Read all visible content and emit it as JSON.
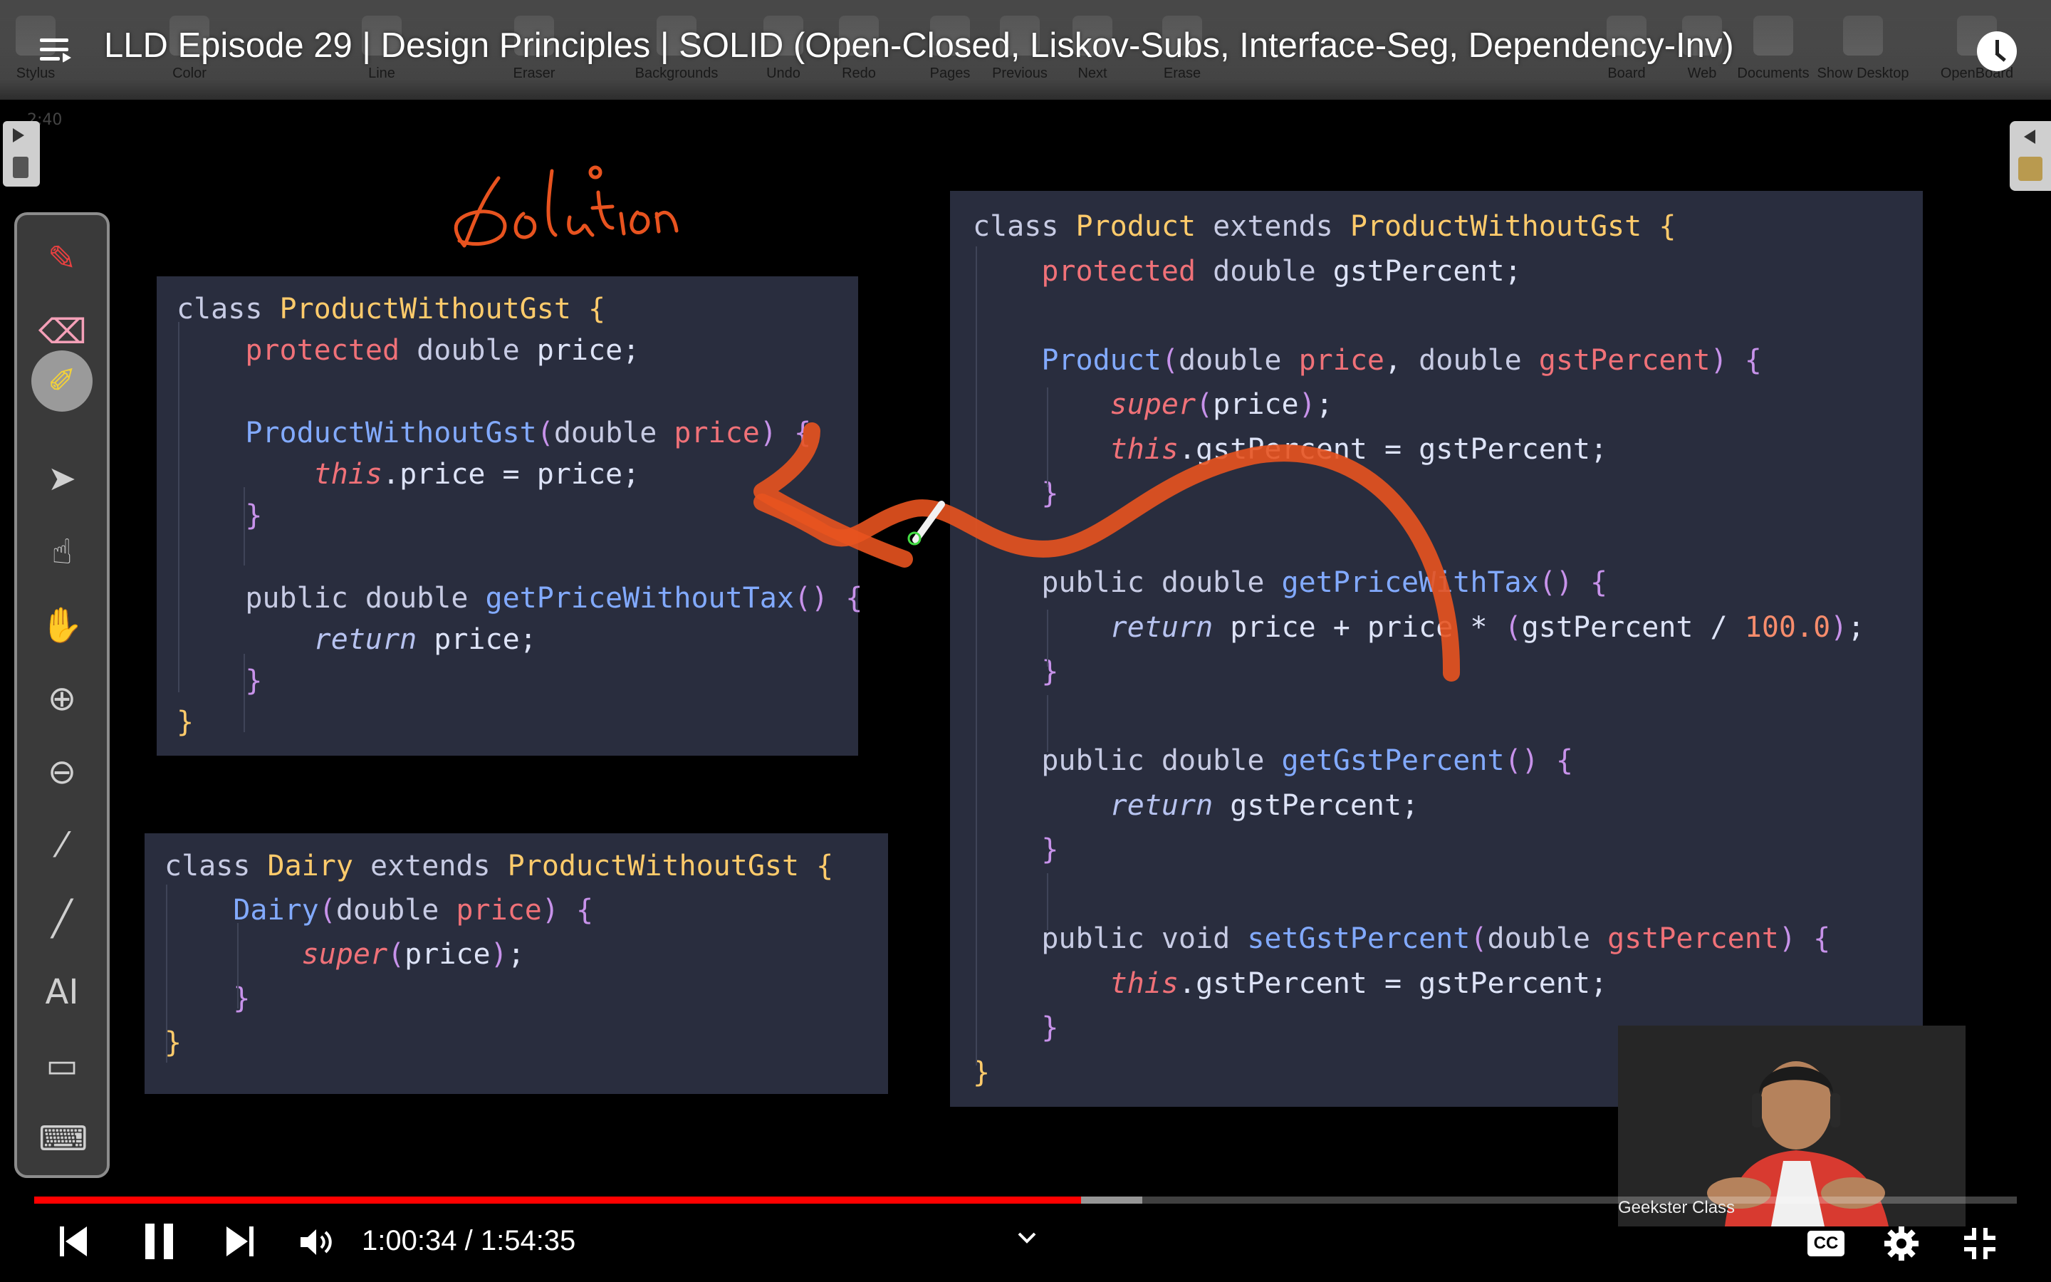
{
  "video": {
    "title": "LLD Episode 29 | Design Principles | SOLID (Open-Closed, Liskov-Subs, Interface-Seg, Dependency-Inv)",
    "current_time": "1:00:34",
    "separator": "/",
    "duration": "1:54:35",
    "progress_fraction": 0.528,
    "buffered_fraction": 0.559,
    "progress_color": "#ff0000"
  },
  "board_toolbar": {
    "items": [
      {
        "label": "Stylus",
        "icon": "stylus-icon"
      },
      {
        "label": "Color",
        "icon": "color-icon"
      },
      {
        "label": "Line",
        "icon": "line-icon"
      },
      {
        "label": "Eraser",
        "icon": "eraser-icon"
      },
      {
        "label": "Backgrounds",
        "icon": "background-icon"
      },
      {
        "label": "Undo",
        "icon": "undo-icon"
      },
      {
        "label": "Redo",
        "icon": "redo-icon"
      },
      {
        "label": "Pages",
        "icon": "pages-icon"
      },
      {
        "label": "Previous",
        "icon": "previous-icon"
      },
      {
        "label": "Next",
        "icon": "next-icon"
      },
      {
        "label": "Erase",
        "icon": "erase-icon"
      },
      {
        "label": "Board",
        "icon": "board-icon"
      },
      {
        "label": "Web",
        "icon": "web-icon"
      },
      {
        "label": "Documents",
        "icon": "documents-icon"
      },
      {
        "label": "Show Desktop",
        "icon": "desktop-icon"
      },
      {
        "label": "OpenBoard",
        "icon": "openboard-icon"
      }
    ],
    "timestamp_small": "2:40"
  },
  "left_tools": [
    {
      "name": "pen-tool-icon",
      "glyph": "✎"
    },
    {
      "name": "eraser-tool-icon",
      "glyph": "⌫"
    },
    {
      "name": "marker-tool-icon",
      "glyph": "✐"
    },
    {
      "name": "selector-tool-icon",
      "glyph": "➤"
    },
    {
      "name": "interact-tool-icon",
      "glyph": "☝"
    },
    {
      "name": "hand-tool-icon",
      "glyph": "✋"
    },
    {
      "name": "zoom-in-icon",
      "glyph": "⊕"
    },
    {
      "name": "zoom-out-icon",
      "glyph": "⊖"
    },
    {
      "name": "laser-pointer-icon",
      "glyph": "⁄"
    },
    {
      "name": "draw-line-icon",
      "glyph": "╱"
    },
    {
      "name": "text-tool-icon",
      "glyph": "AI"
    },
    {
      "name": "capture-icon",
      "glyph": "▭"
    },
    {
      "name": "keyboard-icon",
      "glyph": "⌨"
    }
  ],
  "annotation": {
    "handwritten_text": "Solution",
    "ink_color": "#e8531f"
  },
  "code": {
    "product_without_gst": [
      [
        [
          "kw",
          "class "
        ],
        [
          "cls",
          "ProductWithoutGst"
        ],
        [
          "cls",
          " {"
        ]
      ],
      [
        [
          "t",
          "    "
        ],
        [
          "prm",
          "protected"
        ],
        [
          "kw",
          " double"
        ],
        [
          "t",
          " price;"
        ]
      ],
      [
        [
          "t",
          ""
        ]
      ],
      [
        [
          "t",
          "    "
        ],
        [
          "fn",
          "ProductWithoutGst"
        ],
        [
          "pn",
          "("
        ],
        [
          "kw",
          "double "
        ],
        [
          "prm",
          "price"
        ],
        [
          "pn",
          ")"
        ],
        [
          "pn",
          " {"
        ]
      ],
      [
        [
          "t",
          "        "
        ],
        [
          "it",
          "this"
        ],
        [
          "t",
          ".price = price;"
        ]
      ],
      [
        [
          "t",
          "    "
        ],
        [
          "pn",
          "}"
        ]
      ],
      [
        [
          "t",
          ""
        ]
      ],
      [
        [
          "t",
          "    "
        ],
        [
          "kw",
          "public double "
        ],
        [
          "fn",
          "getPriceWithoutTax"
        ],
        [
          "pn",
          "()"
        ],
        [
          "pn",
          " {"
        ]
      ],
      [
        [
          "t",
          "        "
        ],
        [
          "ret",
          "return"
        ],
        [
          "t",
          " price;"
        ]
      ],
      [
        [
          "t",
          "    "
        ],
        [
          "pn",
          "}"
        ]
      ],
      [
        [
          "cls",
          "}"
        ]
      ]
    ],
    "dairy": [
      [
        [
          "kw",
          "class "
        ],
        [
          "cls",
          "Dairy"
        ],
        [
          "kw",
          " extends "
        ],
        [
          "cls",
          "ProductWithoutGst"
        ],
        [
          "cls",
          " {"
        ]
      ],
      [
        [
          "t",
          "    "
        ],
        [
          "fn",
          "Dairy"
        ],
        [
          "pn",
          "("
        ],
        [
          "kw",
          "double "
        ],
        [
          "prm",
          "price"
        ],
        [
          "pn",
          ")"
        ],
        [
          "pn",
          " {"
        ]
      ],
      [
        [
          "t",
          "        "
        ],
        [
          "it",
          "super"
        ],
        [
          "pn",
          "("
        ],
        [
          "t",
          "price"
        ],
        [
          "pn",
          ")"
        ],
        [
          "t",
          ";"
        ]
      ],
      [
        [
          "t",
          "    "
        ],
        [
          "pn",
          "}"
        ]
      ],
      [
        [
          "cls",
          "}"
        ]
      ]
    ],
    "product": [
      [
        [
          "kw",
          "class "
        ],
        [
          "cls",
          "Product"
        ],
        [
          "kw",
          " extends "
        ],
        [
          "cls",
          "ProductWithoutGst"
        ],
        [
          "cls",
          " {"
        ]
      ],
      [
        [
          "t",
          "    "
        ],
        [
          "prm",
          "protected"
        ],
        [
          "kw",
          " double"
        ],
        [
          "t",
          " gstPercent;"
        ]
      ],
      [
        [
          "t",
          ""
        ]
      ],
      [
        [
          "t",
          "    "
        ],
        [
          "fn",
          "Product"
        ],
        [
          "pn",
          "("
        ],
        [
          "kw",
          "double "
        ],
        [
          "prm",
          "price"
        ],
        [
          "t",
          ", "
        ],
        [
          "kw",
          "double "
        ],
        [
          "prm",
          "gstPercent"
        ],
        [
          "pn",
          ")"
        ],
        [
          "pn",
          " {"
        ]
      ],
      [
        [
          "t",
          "        "
        ],
        [
          "it",
          "super"
        ],
        [
          "pn",
          "("
        ],
        [
          "t",
          "price"
        ],
        [
          "pn",
          ")"
        ],
        [
          "t",
          ";"
        ]
      ],
      [
        [
          "t",
          "        "
        ],
        [
          "it",
          "this"
        ],
        [
          "t",
          ".gstPercent = gstPercent;"
        ]
      ],
      [
        [
          "t",
          "    "
        ],
        [
          "pn",
          "}"
        ]
      ],
      [
        [
          "t",
          ""
        ]
      ],
      [
        [
          "t",
          "    "
        ],
        [
          "kw",
          "public double "
        ],
        [
          "fn",
          "getPriceWithTax"
        ],
        [
          "pn",
          "()"
        ],
        [
          "pn",
          " {"
        ]
      ],
      [
        [
          "t",
          "        "
        ],
        [
          "ret",
          "return"
        ],
        [
          "t",
          " price + price * "
        ],
        [
          "pn",
          "("
        ],
        [
          "t",
          "gstPercent / "
        ],
        [
          "num",
          "100.0"
        ],
        [
          "pn",
          ")"
        ],
        [
          "t",
          ";"
        ]
      ],
      [
        [
          "t",
          "    "
        ],
        [
          "pn",
          "}"
        ]
      ],
      [
        [
          "t",
          ""
        ]
      ],
      [
        [
          "t",
          "    "
        ],
        [
          "kw",
          "public double "
        ],
        [
          "fn",
          "getGstPercent"
        ],
        [
          "pn",
          "()"
        ],
        [
          "pn",
          " {"
        ]
      ],
      [
        [
          "t",
          "        "
        ],
        [
          "ret",
          "return"
        ],
        [
          "t",
          " gstPercent;"
        ]
      ],
      [
        [
          "t",
          "    "
        ],
        [
          "pn",
          "}"
        ]
      ],
      [
        [
          "t",
          ""
        ]
      ],
      [
        [
          "t",
          "    "
        ],
        [
          "kw",
          "public void "
        ],
        [
          "fn",
          "setGstPercent"
        ],
        [
          "pn",
          "("
        ],
        [
          "kw",
          "double "
        ],
        [
          "prm",
          "gstPercent"
        ],
        [
          "pn",
          ")"
        ],
        [
          "pn",
          " {"
        ]
      ],
      [
        [
          "t",
          "        "
        ],
        [
          "it",
          "this"
        ],
        [
          "t",
          ".gstPercent = gstPercent;"
        ]
      ],
      [
        [
          "t",
          "    "
        ],
        [
          "pn",
          "}"
        ]
      ],
      [
        [
          "cls",
          "}"
        ]
      ]
    ]
  },
  "webcam": {
    "label": "Geekster Class"
  },
  "controls": {
    "prev_icon": "previous-video-icon",
    "pause_icon": "pause-icon",
    "next_icon": "next-video-icon",
    "volume_icon": "volume-icon",
    "chapter_chevron_icon": "chevron-down-icon",
    "cc_label": "CC",
    "settings_icon": "settings-gear-icon",
    "exit_fullscreen_icon": "exit-fullscreen-icon"
  }
}
